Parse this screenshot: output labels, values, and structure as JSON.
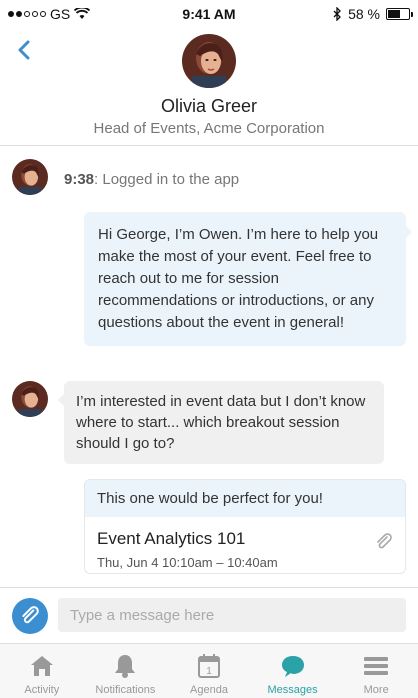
{
  "status_bar": {
    "carrier": "GS",
    "time": "9:41 AM",
    "battery": "58 %",
    "battery_level": 0.58
  },
  "header": {
    "contact_name": "Olivia Greer",
    "contact_role": "Head of Events, Acme Corporation"
  },
  "chat": {
    "log": {
      "time": "9:38",
      "text": ": Logged in to the app"
    },
    "outgoing_message": "Hi George, I’m Owen. I’m here to help you make the most of your event. Feel free to reach out to me for session recommendations or introductions, or any questions about the event in general!",
    "incoming_message": "I’m interested in event data but I don’t know where to start... which breakout session should I go to?",
    "recommendation": {
      "text": "This one would be perfect for you!",
      "session_title": "Event Analytics 101",
      "session_time": "Thu, Jun 4 10:10am – 10:40am"
    }
  },
  "composer": {
    "placeholder": "Type a message here"
  },
  "tabbar": {
    "items": [
      {
        "label": "Activity",
        "icon": "home-icon"
      },
      {
        "label": "Notifications",
        "icon": "bell-icon"
      },
      {
        "label": "Agenda",
        "icon": "calendar-icon"
      },
      {
        "label": "Messages",
        "icon": "chat-bubble-icon"
      },
      {
        "label": "More",
        "icon": "menu-icon"
      }
    ],
    "active_index": 3
  },
  "colors": {
    "accent_blue": "#3b8fd0",
    "active_tab": "#2ba1a8",
    "outgoing_bubble": "#ecf4fb",
    "incoming_bubble": "#f0f0f0"
  }
}
